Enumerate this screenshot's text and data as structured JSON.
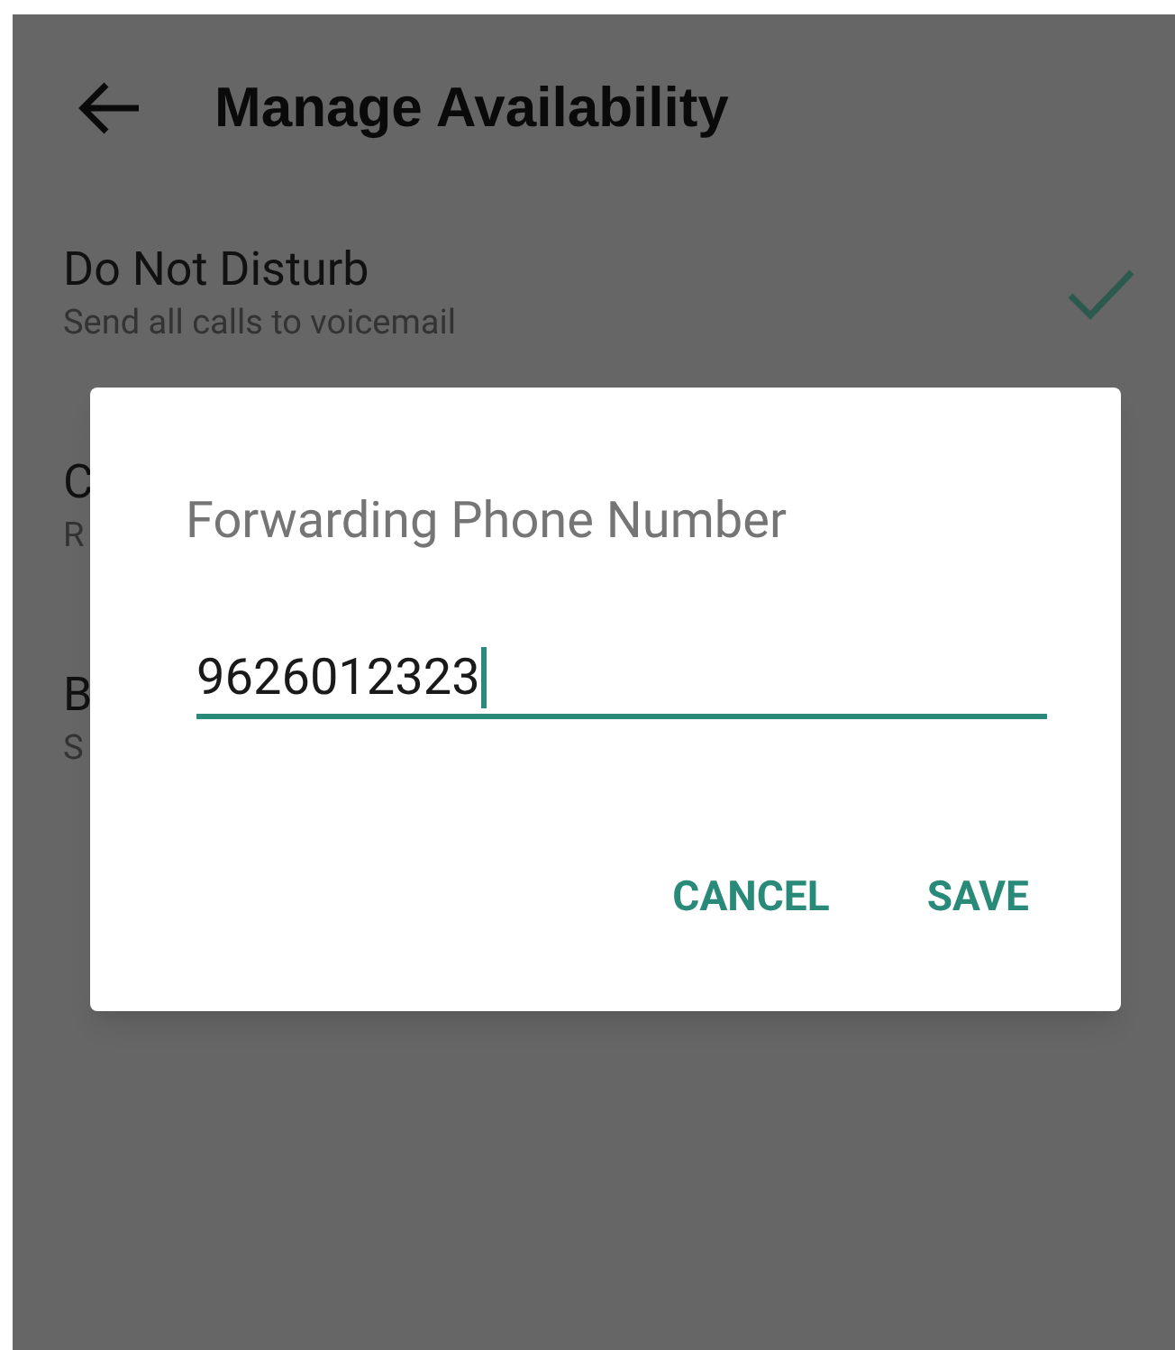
{
  "header": {
    "title": "Manage Availability"
  },
  "options": [
    {
      "title": "Do Not Disturb",
      "subtitle": "Send all calls to voicemail",
      "checked": true
    },
    {
      "title": "C",
      "subtitle": "R",
      "checked": false
    },
    {
      "title": "B",
      "subtitle": "S",
      "checked": false
    }
  ],
  "dialog": {
    "title": "Forwarding Phone Number",
    "field": {
      "value": "9626012323",
      "focused": true
    },
    "buttons": [
      "CANCEL",
      "SAVE"
    ]
  }
}
